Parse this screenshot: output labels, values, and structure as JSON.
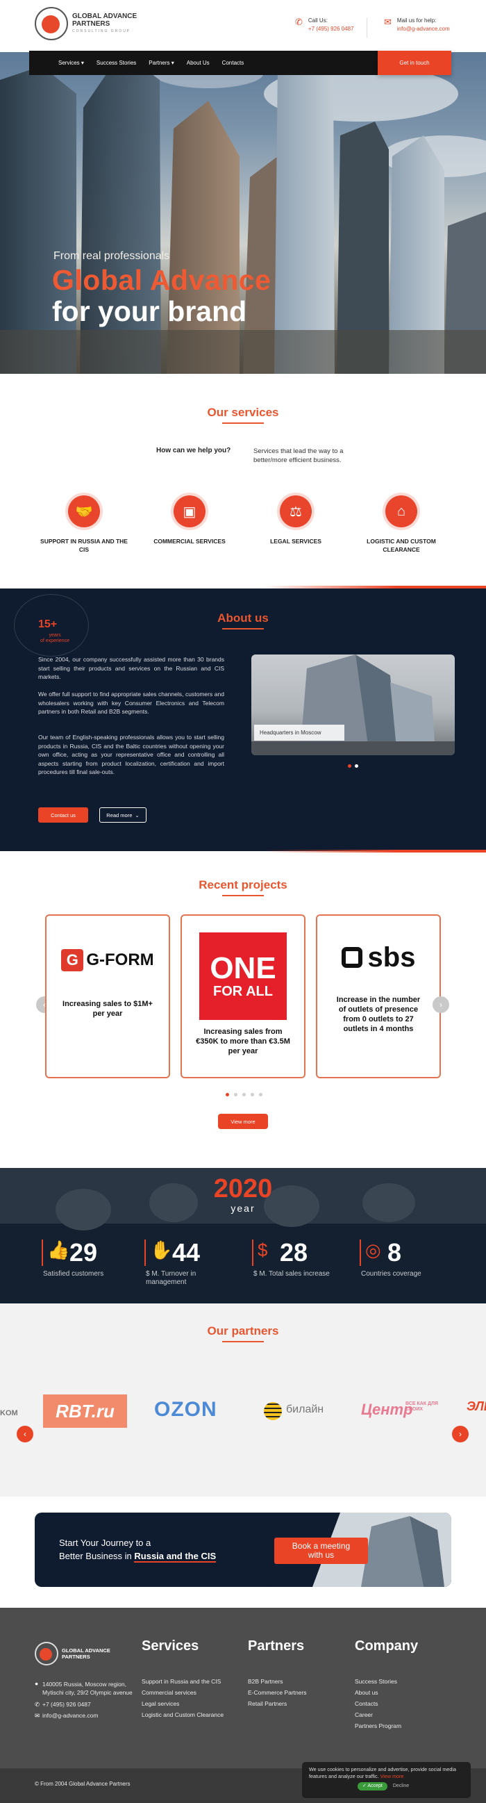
{
  "header": {
    "logo": {
      "line1": "GLOBAL ADVANCE",
      "line2": "PARTNERS",
      "line3": "CONSULTING GROUP"
    },
    "call": {
      "label": "Call Us:",
      "value": "+7 (495) 926 0487",
      "icon": "phone-icon"
    },
    "mail": {
      "label": "Mail us for help:",
      "value": "info@g-advance.com",
      "icon": "mail-icon"
    }
  },
  "nav": {
    "items": [
      "Services ▾",
      "Success Stories",
      "Partners ▾",
      "About Us",
      "Contacts"
    ],
    "cta": "Get in touch"
  },
  "hero": {
    "line1": "From real professionals",
    "line2": "Global Advance",
    "line3": "for your brand"
  },
  "services": {
    "title": "Our services",
    "question": "How can we help you?",
    "answer": "Services that lead the way to a better/more efficient business.",
    "items": [
      {
        "label": "SUPPORT IN RUSSIA AND THE CIS",
        "icon": "handshake-icon"
      },
      {
        "label": "COMMERCIAL SERVICES",
        "icon": "presentation-icon"
      },
      {
        "label": "LEGAL SERVICES",
        "icon": "scales-icon"
      },
      {
        "label": "LOGISTIC AND CUSTOM CLEARANCE",
        "icon": "warehouse-icon"
      }
    ]
  },
  "about": {
    "badge_num": "15+",
    "badge_l1": "years",
    "badge_l2": "of experience",
    "title": "About us",
    "p1": "Since 2004, our company successfully assisted more than 30 brands start selling their products and services on the Russian and CIS markets.",
    "p2": "We offer full support to find appropriate sales channels, customers and wholesalers working with key Consumer Electronics and Telecom partners in both Retail and B2B segments.",
    "p3": "Our team of English-speaking professionals allows you to start selling products in Russia, CIS and the Baltic countries without opening your own office, acting as your representative office and controlling all aspects starting from product localization, certification and import procedures till final sale-outs.",
    "contact_btn": "Contact us",
    "read_more": "Read more",
    "photo_caption": "Headquarters in Moscow"
  },
  "projects": {
    "title": "Recent projects",
    "items": [
      {
        "brand": "G-FORM",
        "text": "Increasing sales to $1M+ per year"
      },
      {
        "brand_l1": "ONE",
        "brand_l2": "FOR ALL",
        "text": "Increasing sales from €350K to more than €3.5M per year"
      },
      {
        "brand": "sbs",
        "text": "Increase in the number of outlets of presence from 0 outlets to 27 outlets in 4 months"
      }
    ],
    "view_more": "View more"
  },
  "stats": {
    "year": "2020",
    "year_label": "year",
    "items": [
      {
        "num": "29",
        "label": "Satisfied customers",
        "icon": "thumbs-up-icon"
      },
      {
        "num": "44",
        "label": "$ M. Turnover in management",
        "icon": "hand-money-icon"
      },
      {
        "num": "28",
        "label": "$ M. Total sales increase",
        "icon": "dollar-chart-icon"
      },
      {
        "num": "8",
        "label": "Countries coverage",
        "icon": "globe-icon"
      }
    ]
  },
  "partners": {
    "title": "Our partners",
    "logos": [
      "KOM",
      "RBT.ru",
      "OZON",
      "билайн",
      "Центр",
      "ВСЕ КАК ДЛЯ СВОИХ",
      "ЭЛЬ"
    ]
  },
  "cta": {
    "line1": "Start Your Journey to a",
    "line2a": "Better Business in ",
    "line2b": "Russia and the CIS",
    "button": "Book a meeting with us"
  },
  "footer": {
    "logo": {
      "line1": "GLOBAL ADVANCE",
      "line2": "PARTNERS"
    },
    "address": "140005 Russia, Moscow region, Mytischi city, 29/2 Olympic avenue",
    "phone": "+7 (495) 926 0487",
    "email": "info@g-advance.com",
    "services": {
      "title": "Services",
      "links": [
        "Support in Russia and the CIS",
        "Commercial services",
        "Legal services",
        "Logistic and Custom Clearance"
      ]
    },
    "partners": {
      "title": "Partners",
      "links": [
        "B2B Partners",
        "E-Commerce Partners",
        "Retail Partners"
      ]
    },
    "company": {
      "title": "Company",
      "links": [
        "Success Stories",
        "About us",
        "Contacts",
        "Career",
        "Partners Program"
      ]
    },
    "copyright": "© From 2004 Global Advance Partners"
  },
  "cookie": {
    "text": "We use cookies to personalize and advertise, provide social media features and analyze our traffic.",
    "link": "View more",
    "accept": "✓ Accept",
    "decline": "Decline"
  },
  "colors": {
    "accent": "#ea4426",
    "dark": "#0f1b2e",
    "footer": "#4d4d4d"
  }
}
